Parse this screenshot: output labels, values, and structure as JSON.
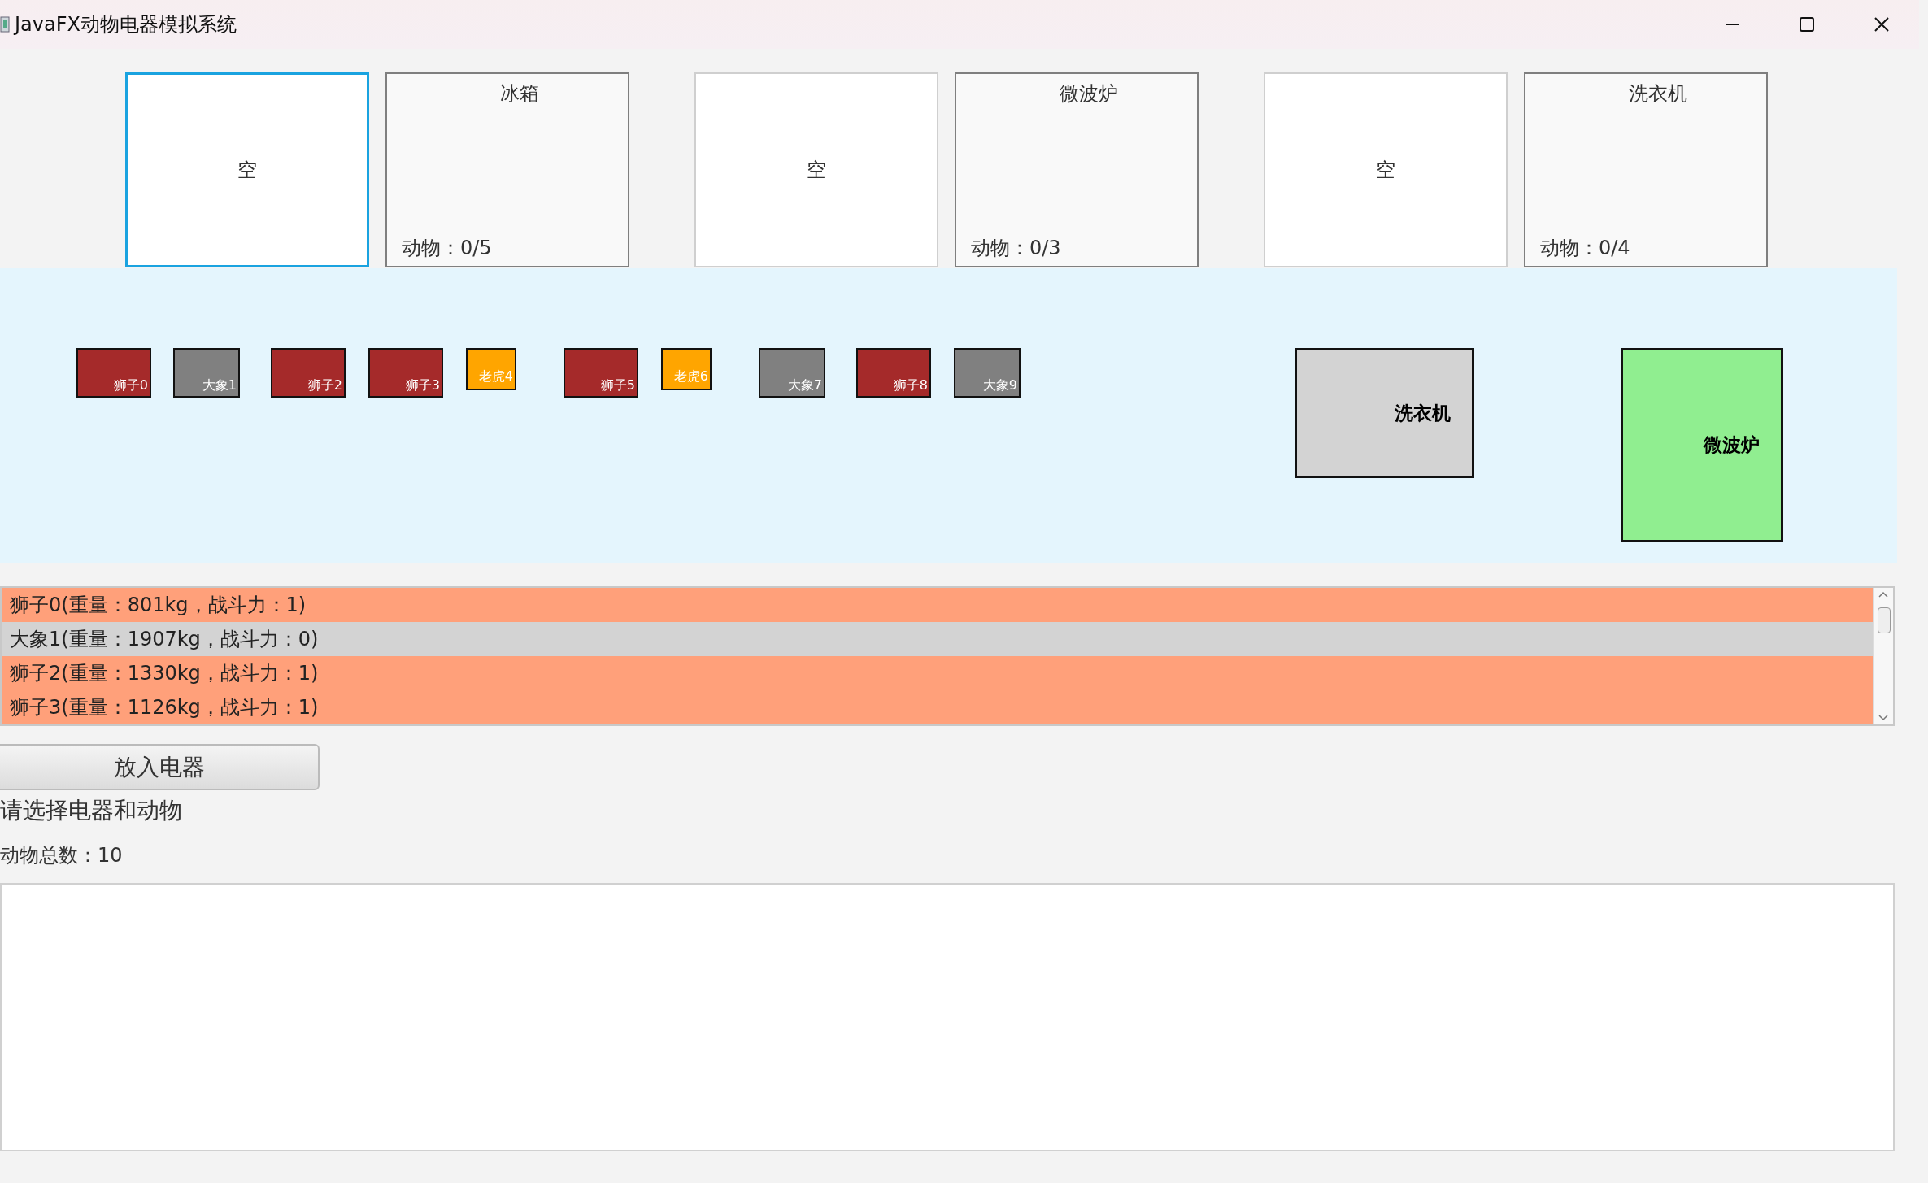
{
  "window": {
    "title": "JavaFX动物电器模拟系统"
  },
  "slots": [
    {
      "kind": "empty",
      "label": "空",
      "selected": true
    },
    {
      "kind": "appliance",
      "name": "冰箱",
      "count": "动物：0/5",
      "selected": false
    },
    {
      "kind": "empty",
      "label": "空",
      "selected": false
    },
    {
      "kind": "appliance",
      "name": "微波炉",
      "count": "动物：0/3",
      "selected": false
    },
    {
      "kind": "empty",
      "label": "空",
      "selected": false
    },
    {
      "kind": "appliance",
      "name": "洗衣机",
      "count": "动物：0/4",
      "selected": false
    }
  ],
  "animals": [
    {
      "kind": "lion",
      "label": "狮子0",
      "color": "#a52a2a"
    },
    {
      "kind": "elephant",
      "label": "大象1",
      "color": "#808080"
    },
    {
      "kind": "lion",
      "label": "狮子2",
      "color": "#a52a2a"
    },
    {
      "kind": "lion",
      "label": "狮子3",
      "color": "#a52a2a"
    },
    {
      "kind": "tiger",
      "label": "老虎4",
      "color": "#ffa500"
    },
    {
      "kind": "lion",
      "label": "狮子5",
      "color": "#a52a2a"
    },
    {
      "kind": "tiger",
      "label": "老虎6",
      "color": "#ffa500"
    },
    {
      "kind": "elephant",
      "label": "大象7",
      "color": "#808080"
    },
    {
      "kind": "lion",
      "label": "狮子8",
      "color": "#a52a2a"
    },
    {
      "kind": "elephant",
      "label": "大象9",
      "color": "#808080"
    }
  ],
  "appliances": [
    {
      "label": "洗衣机",
      "color": "#d3d3d3"
    },
    {
      "label": "微波炉",
      "color": "#90ee90"
    }
  ],
  "list": [
    {
      "text": "狮子0(重量：801kg，战斗力：1)",
      "color": "#ffa07a"
    },
    {
      "text": "大象1(重量：1907kg，战斗力：0)",
      "color": "#d3d3d3"
    },
    {
      "text": "狮子2(重量：1330kg，战斗力：1)",
      "color": "#ffa07a"
    },
    {
      "text": "狮子3(重量：1126kg，战斗力：1)",
      "color": "#ffa07a"
    }
  ],
  "button": "放入电器",
  "message": "请选择电器和动物",
  "total": "动物总数：10"
}
